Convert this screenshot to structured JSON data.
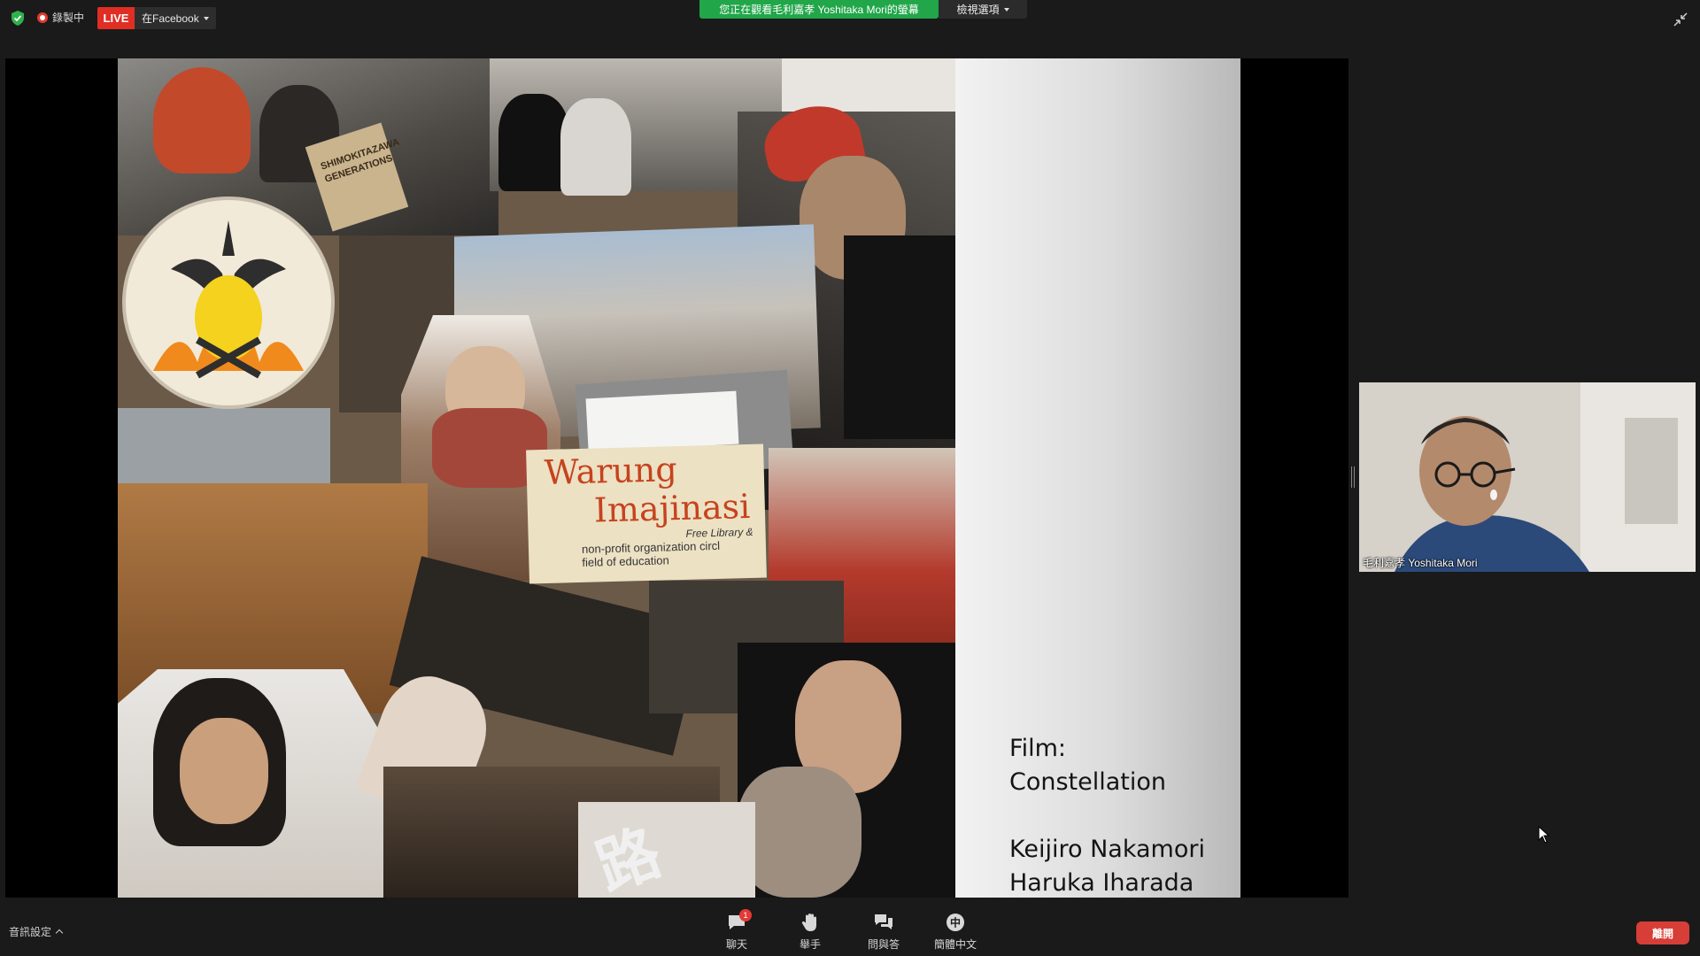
{
  "topbar": {
    "recording_label": "錄製中",
    "live_badge": "LIVE",
    "live_target": "在Facebook",
    "share_banner": "您正在觀看毛利嘉孝 Yoshitaka  Mori的螢幕",
    "view_options": "檢視選項",
    "icons": [
      "shield-check-icon",
      "record-icon",
      "caret-down-icon",
      "exit-fullscreen-icon"
    ]
  },
  "slide": {
    "warung_line1": "Warung",
    "warung_line2": "Imajinasi",
    "warung_line3": "Free Library &",
    "warung_line4": "non-profit organization circl",
    "warung_line5": "field of education",
    "sign_text": "SHIMOKITAZAWA GENERATIONS",
    "film_label": "Film:",
    "film_title": "Constellation",
    "credit_1": "Keijiro Nakamori",
    "credit_2": "Haruka Iharada"
  },
  "participant": {
    "name": "毛利嘉孝 Yoshitaka Mori"
  },
  "bottombar": {
    "audio_settings": "音訊設定",
    "chat_label": "聊天",
    "chat_badge": "1",
    "raise_hand_label": "舉手",
    "qa_label": "問與答",
    "interpretation_label": "簡體中文",
    "interpretation_glyph": "中",
    "leave_label": "離開"
  },
  "colors": {
    "live_red": "#e02e24",
    "share_green": "#21a64a",
    "leave_red": "#d63e37",
    "background": "#1a1a1a"
  }
}
